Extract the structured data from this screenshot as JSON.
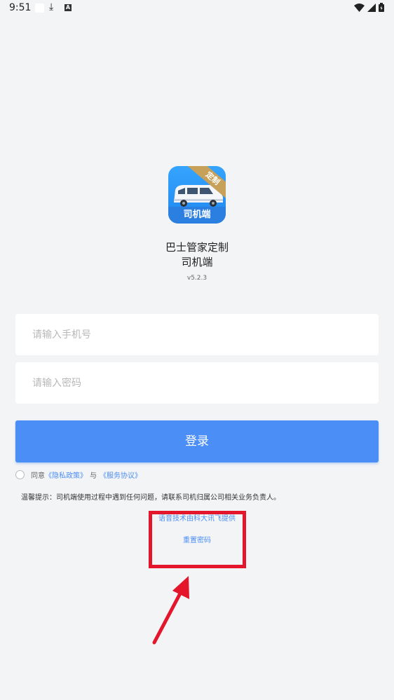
{
  "status_bar": {
    "time": "9:51",
    "icons": [
      "notification-box-icon",
      "download-icon",
      "a-badge-icon",
      "wifi-icon",
      "signal-icon",
      "battery-icon"
    ]
  },
  "app": {
    "icon_ribbon_text": "定制",
    "icon_bottom_text": "司机端",
    "name_line1": "巴士管家定制",
    "name_line2": "司机端",
    "version": "v5.2.3"
  },
  "form": {
    "phone_placeholder": "请输入手机号",
    "phone_value": "",
    "password_placeholder": "请输入密码",
    "password_value": "",
    "login_label": "登录"
  },
  "agreement": {
    "prefix": "同意",
    "privacy_link": "《隐私政策》",
    "connector": "与",
    "service_link": "《服务协议》"
  },
  "tip": "温馨提示：司机端使用过程中遇到任何问题，请联系司机归属公司相关业务负责人。",
  "tech_provider": "语音技术由科大讯飞提供",
  "reset_password": "重置密码",
  "colors": {
    "accent": "#4b8ef6",
    "background": "#f3f4f6",
    "highlight": "#e3162b",
    "icon_gold": "#c7a159"
  }
}
